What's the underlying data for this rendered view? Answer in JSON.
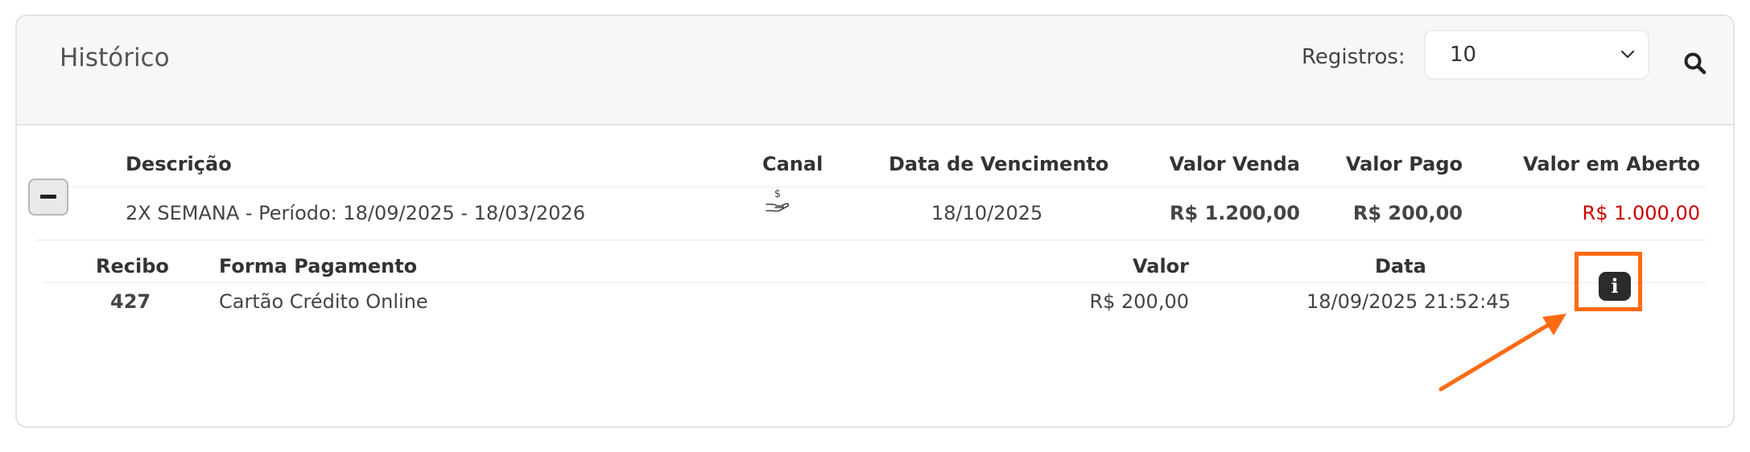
{
  "header": {
    "title": "Histórico",
    "registros_label": "Registros:",
    "registros_value": "10",
    "search_icon": "search-icon"
  },
  "table": {
    "columns": [
      "Descrição",
      "Canal",
      "Data de Vencimento",
      "Valor Venda",
      "Valor Pago",
      "Valor em Aberto"
    ],
    "row": {
      "descricao": "2X SEMANA - Período: 18/09/2025 - 18/03/2026",
      "canal_icon": "hand-money-icon",
      "data_vencimento": "18/10/2025",
      "valor_venda": "R$ 1.200,00",
      "valor_pago": "R$ 200,00",
      "valor_aberto": "R$ 1.000,00"
    }
  },
  "subtable": {
    "columns": [
      "Recibo",
      "Forma Pagamento",
      "Valor",
      "Data"
    ],
    "row": {
      "recibo": "427",
      "forma_pagamento": "Cartão Crédito Online",
      "valor": "R$ 200,00",
      "data": "18/09/2025 21:52:45",
      "info_icon": "info-icon"
    }
  },
  "colors": {
    "highlight": "#ff6a13",
    "open_value": "#cc0000"
  }
}
